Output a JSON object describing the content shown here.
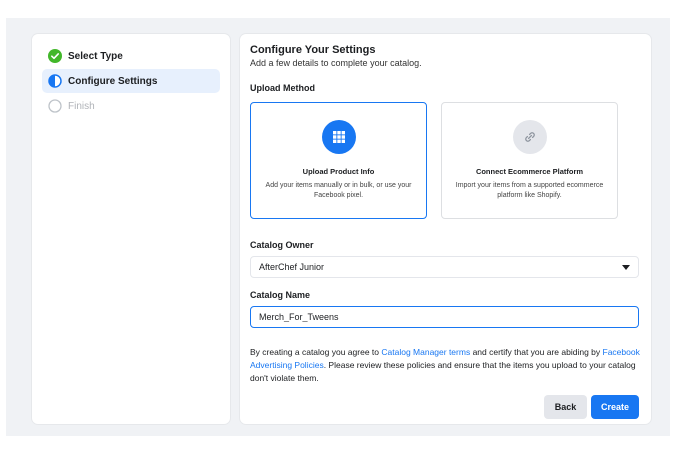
{
  "steps": [
    {
      "label": "Select Type",
      "state": "done"
    },
    {
      "label": "Configure Settings",
      "state": "active"
    },
    {
      "label": "Finish",
      "state": "pending"
    }
  ],
  "header": {
    "title": "Configure Your Settings",
    "subtitle": "Add a few details to complete your catalog."
  },
  "upload_method": {
    "label": "Upload Method",
    "options": [
      {
        "title": "Upload Product Info",
        "description": "Add your items manually or in bulk, or use your Facebook pixel.",
        "icon": "grid-icon",
        "selected": true
      },
      {
        "title": "Connect Ecommerce Platform",
        "description": "Import your items from a supported ecommerce platform like Shopify.",
        "icon": "link-icon",
        "selected": false
      }
    ]
  },
  "catalog_owner": {
    "label": "Catalog Owner",
    "value": "AfterChef Junior"
  },
  "catalog_name": {
    "label": "Catalog Name",
    "value": "Merch_For_Tweens"
  },
  "consent": {
    "part1": "By creating a catalog you agree to ",
    "link1": "Catalog Manager terms",
    "part2": " and certify that you are abiding by ",
    "link2": "Facebook Advertising Policies",
    "part3": ". Please review these policies and ensure that the items you upload to your catalog don't violate them."
  },
  "buttons": {
    "back": "Back",
    "create": "Create"
  },
  "colors": {
    "accent": "#1877f2",
    "success": "#42b72a",
    "background": "#f0f2f5"
  }
}
